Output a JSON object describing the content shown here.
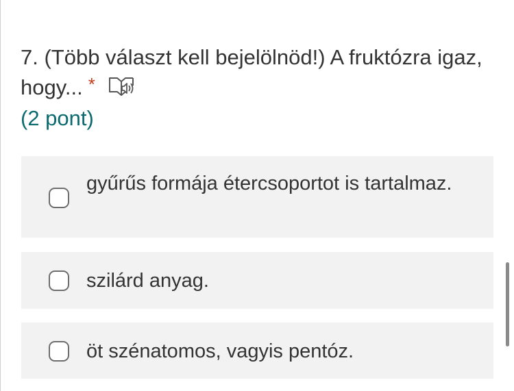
{
  "question": {
    "text": "7. (Több választ kell bejelölnöd!) A fruktózra igaz, hogy...",
    "required_mark": "*",
    "points": "(2 pont)",
    "speaker_icon": "immersive-reader-speaker-icon"
  },
  "options": [
    {
      "label": "gyűrűs formája étercsoportot is tartalmaz.",
      "checked": false
    },
    {
      "label": "szilárd anyag.",
      "checked": false
    },
    {
      "label": "öt szénatomos, vagyis pentóz.",
      "checked": false
    }
  ],
  "colors": {
    "text": "#333333",
    "points": "#0b6a6f",
    "required": "#c43b1d",
    "option_background": "#f2f2f2"
  }
}
